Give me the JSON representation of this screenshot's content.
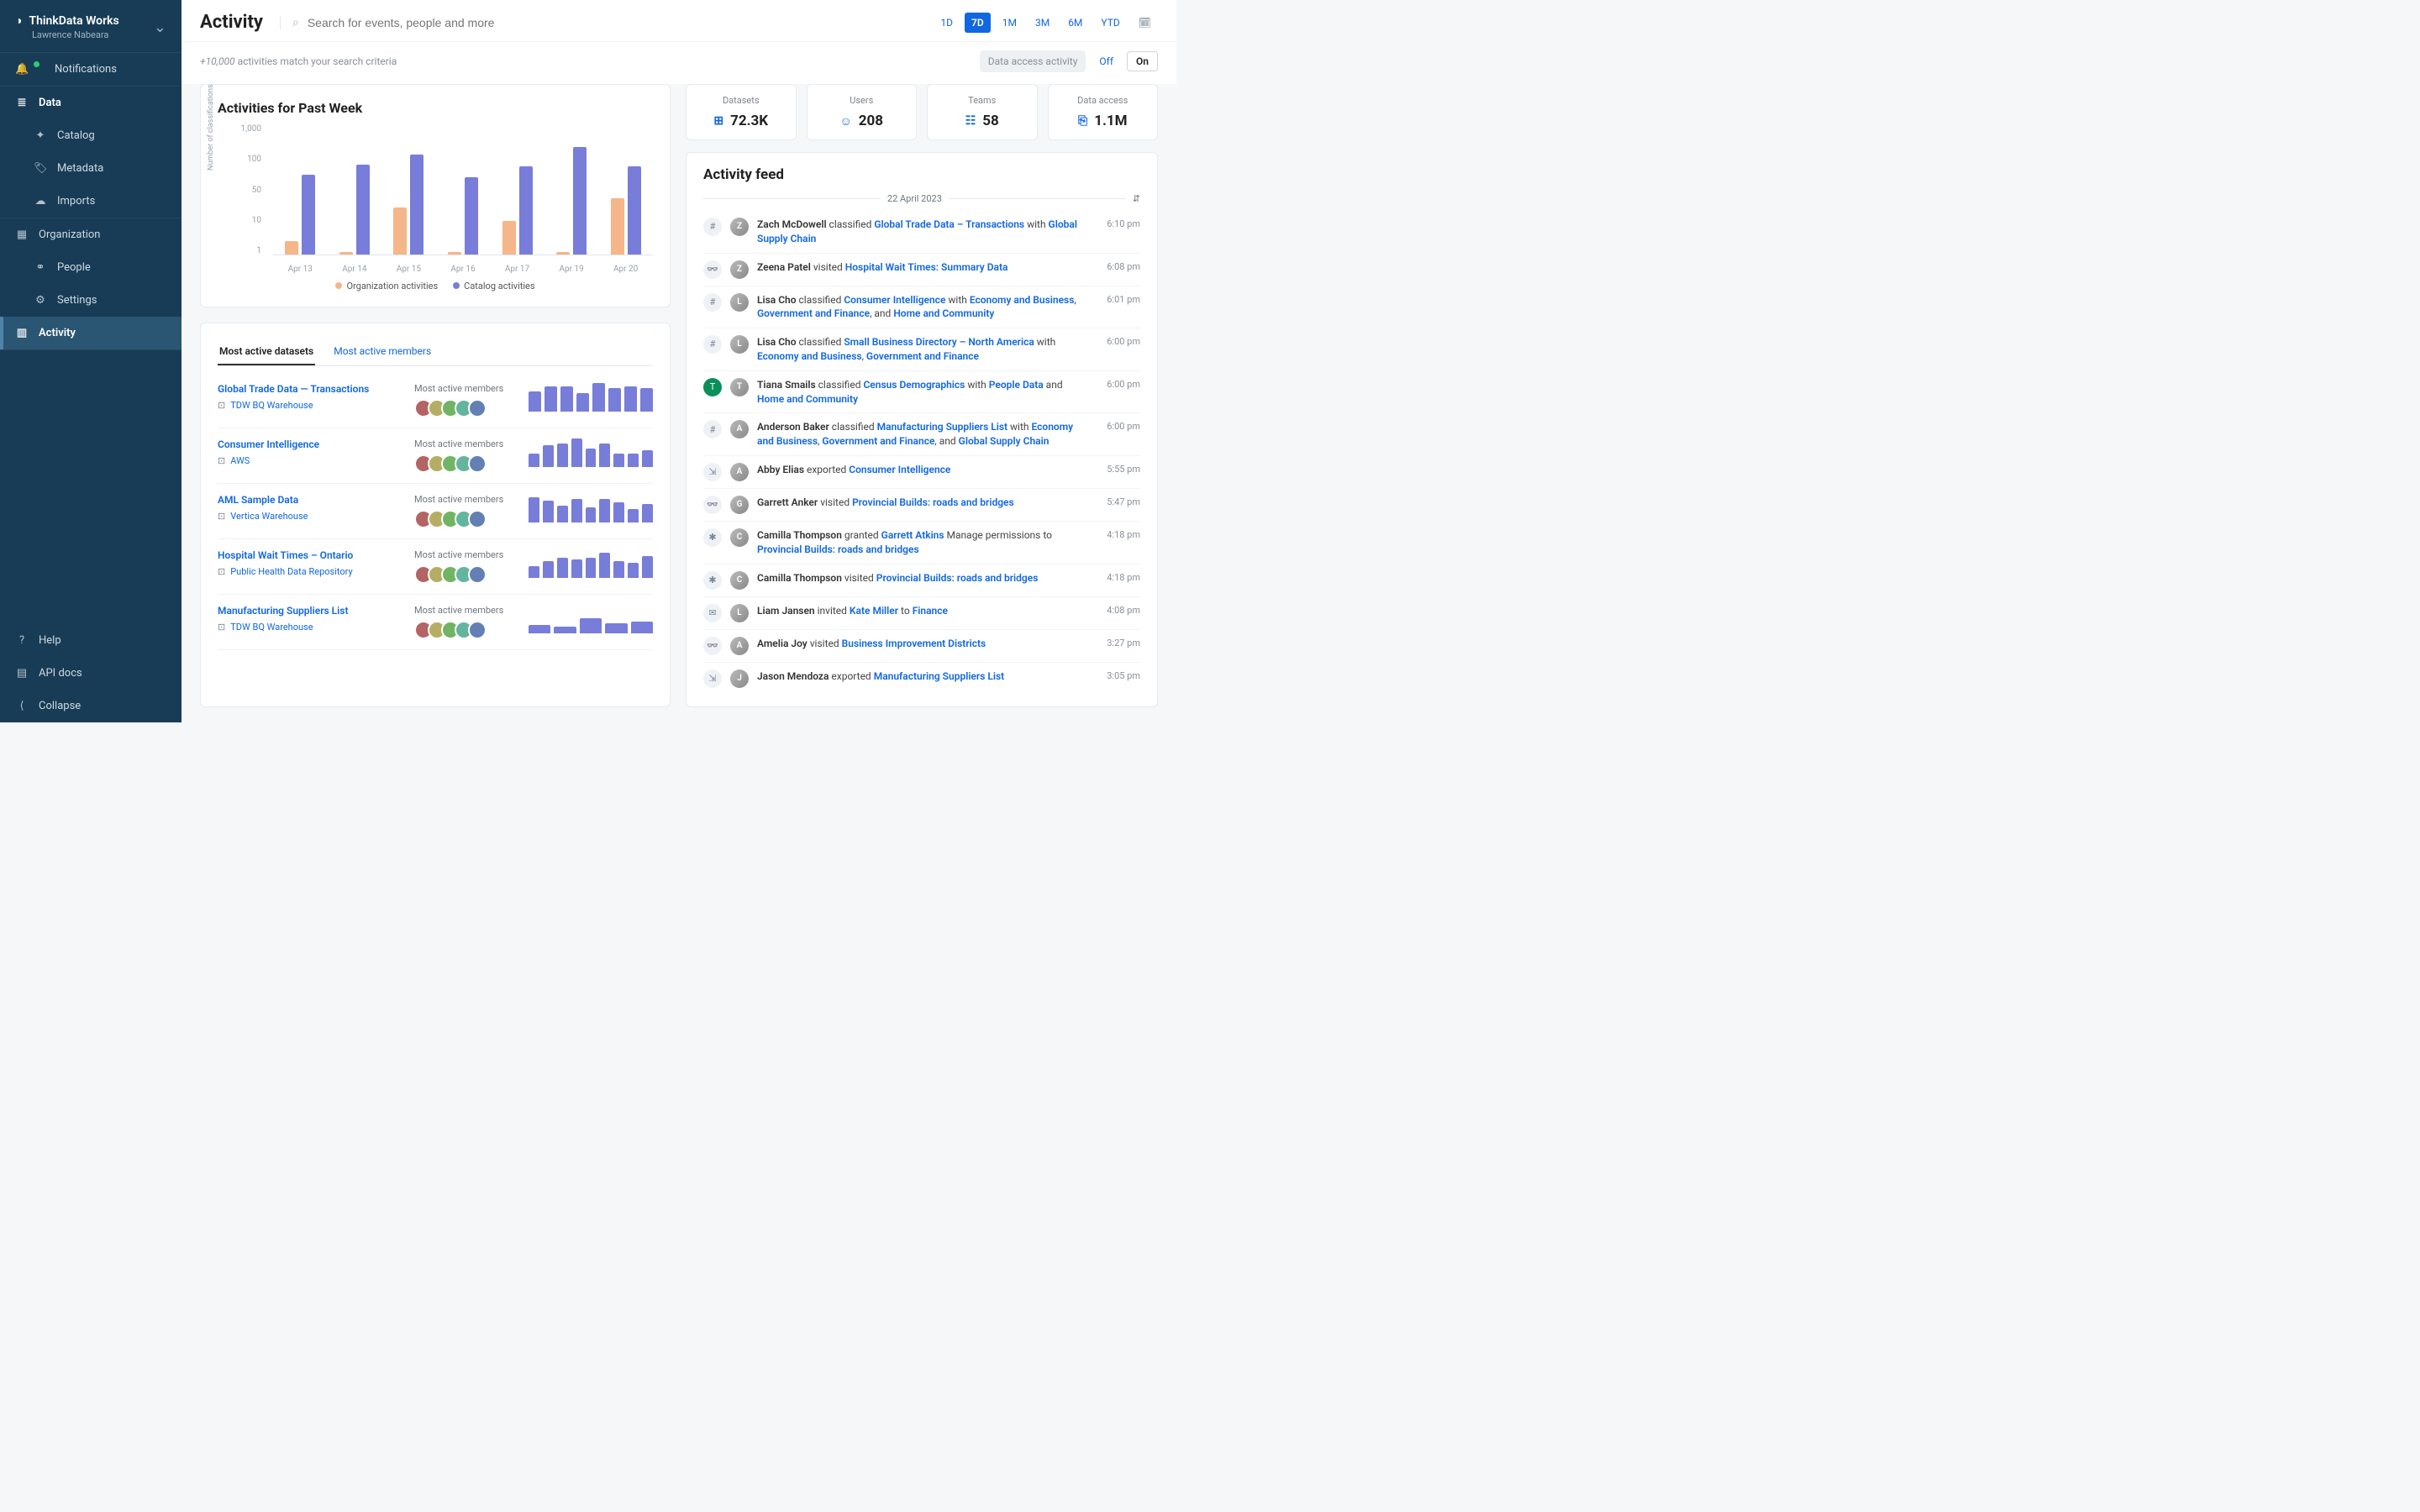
{
  "org": {
    "name": "ThinkData Works",
    "user": "Lawrence Nabeara"
  },
  "nav": {
    "notifications": "Notifications",
    "data": "Data",
    "catalog": "Catalog",
    "metadata": "Metadata",
    "imports": "Imports",
    "organization": "Organization",
    "people": "People",
    "settings": "Settings",
    "activity": "Activity",
    "help": "Help",
    "api": "API docs",
    "collapse": "Collapse"
  },
  "header": {
    "title": "Activity",
    "search_placeholder": "Search for events, people and more",
    "ranges": [
      "1D",
      "7D",
      "1M",
      "3M",
      "6M",
      "YTD"
    ],
    "range_active": "7D"
  },
  "subbar": {
    "count_prefix": "+10,000",
    "count_suffix": " activities match your search criteria",
    "data_access": "Data access activity",
    "off": "Off",
    "on": "On"
  },
  "chart_data": {
    "type": "bar",
    "title": "Activities for Past Week",
    "ylabel": "Number of classifications",
    "categories": [
      "Apr 13",
      "Apr 14",
      "Apr 15",
      "Apr 16",
      "Apr 17",
      "Apr 19",
      "Apr 20"
    ],
    "yticks": [
      "1,000",
      "100",
      "50",
      "10",
      "1"
    ],
    "series": [
      {
        "name": "Organization activities",
        "color": "#f5b68a",
        "values": [
          2,
          1,
          12,
          1,
          6,
          1,
          20
        ]
      },
      {
        "name": "Catalog activities",
        "color": "#787dd9",
        "values": [
          70,
          120,
          200,
          60,
          110,
          300,
          110
        ]
      }
    ],
    "scale": "log",
    "ylim": [
      1,
      1000
    ]
  },
  "stats": [
    {
      "label": "Datasets",
      "value": "72.3K",
      "icon": "⊞"
    },
    {
      "label": "Users",
      "value": "208",
      "icon": "☺"
    },
    {
      "label": "Teams",
      "value": "58",
      "icon": "☷"
    },
    {
      "label": "Data access",
      "value": "1.1M",
      "icon": "⎘"
    }
  ],
  "tabs": {
    "datasets": "Most active datasets",
    "members": "Most active members"
  },
  "datasets": [
    {
      "name": "Global Trade Data — Transactions",
      "source": "TDW BQ Warehouse",
      "bars": [
        24,
        30,
        30,
        22,
        34,
        28,
        30,
        28
      ]
    },
    {
      "name": "Consumer Intelligence",
      "source": "AWS",
      "bars": [
        16,
        26,
        28,
        34,
        22,
        28,
        16,
        16,
        20
      ]
    },
    {
      "name": "AML Sample Data",
      "source": "Vertica Warehouse",
      "bars": [
        30,
        26,
        20,
        28,
        18,
        28,
        24,
        16,
        22
      ]
    },
    {
      "name": "Hospital Wait Times – Ontario",
      "source": "Public Health Data Repository",
      "bars": [
        14,
        20,
        24,
        22,
        24,
        30,
        20,
        18,
        26
      ]
    },
    {
      "name": "Manufacturing Suppliers List",
      "source": "TDW BQ Warehouse",
      "bars": [
        10,
        8,
        18,
        12,
        14
      ]
    }
  ],
  "datasets_members_label": "Most active members",
  "feed": {
    "title": "Activity feed",
    "date": "22 April 2023",
    "items": [
      {
        "icon": "#",
        "user": "Zach McDowell",
        "verb": "classified",
        "links": [
          "Global Trade Data – Transactions"
        ],
        "extra": " with ",
        "links2": [
          "Global Supply Chain"
        ],
        "time": "6:10 pm"
      },
      {
        "icon": "👓",
        "user": "Zeena Patel",
        "verb": "visited",
        "links": [
          "Hospital Wait Times: Summary Data"
        ],
        "time": "6:08 pm"
      },
      {
        "icon": "#",
        "user": "Lisa Cho",
        "verb": "classified",
        "links": [
          "Consumer Intelligence"
        ],
        "extra": " with ",
        "links2": [
          "Economy and Business",
          "Government and Finance"
        ],
        "tail": ", and ",
        "links3": [
          "Home and Community"
        ],
        "time": "6:01 pm"
      },
      {
        "icon": "#",
        "user": "Lisa Cho",
        "verb": "classified",
        "links": [
          "Small Business Directory – North America"
        ],
        "extra": " with ",
        "links2": [
          "Economy and Business",
          "Government and Finance"
        ],
        "time": "6:00 pm"
      },
      {
        "icon": "T",
        "iconbg": "#0b8f5a",
        "user": "Tiana Smails",
        "verb": "classified",
        "links": [
          "Census Demographics"
        ],
        "extra": " with ",
        "links2": [
          "People Data"
        ],
        "tail": " and ",
        "links3": [
          "Home and Community"
        ],
        "time": "6:00 pm"
      },
      {
        "icon": "#",
        "user": "Anderson Baker",
        "verb": "classified",
        "links": [
          "Manufacturing Suppliers List"
        ],
        "extra": " with ",
        "links2": [
          "Economy and Business",
          "Government and Finance"
        ],
        "tail": ", and ",
        "links3": [
          "Global Supply Chain"
        ],
        "time": "6:00 pm"
      },
      {
        "icon": "⇲",
        "user": "Abby Elias",
        "verb": "exported",
        "links": [
          "Consumer Intelligence"
        ],
        "time": "5:55 pm"
      },
      {
        "icon": "👓",
        "user": "Garrett Anker",
        "verb": "visited",
        "links": [
          "Provincial Builds: roads and bridges"
        ],
        "time": "5:47 pm"
      },
      {
        "icon": "✱",
        "user": "Camilla Thompson",
        "verb": "granted",
        "links": [
          "Garrett Atkins"
        ],
        "extra": " Manage permissions to ",
        "links2": [
          "Provincial Builds: roads and bridges"
        ],
        "time": "4:18 pm"
      },
      {
        "icon": "✱",
        "user": "Camilla Thompson",
        "verb": "visited",
        "links": [
          "Provincial Builds: roads and bridges"
        ],
        "time": "4:18 pm"
      },
      {
        "icon": "✉",
        "user": "Liam Jansen",
        "verb": "invited",
        "links": [
          "Kate Miller"
        ],
        "extra": " to ",
        "links2": [
          "Finance"
        ],
        "time": "4:08 pm"
      },
      {
        "icon": "👓",
        "user": "Amelia Joy",
        "verb": "visited",
        "links": [
          "Business Improvement Districts"
        ],
        "time": "3:27 pm"
      },
      {
        "icon": "⇲",
        "user": "Jason Mendoza",
        "verb": "exported",
        "links": [
          "Manufacturing Suppliers List"
        ],
        "time": "3:05 pm"
      }
    ]
  }
}
